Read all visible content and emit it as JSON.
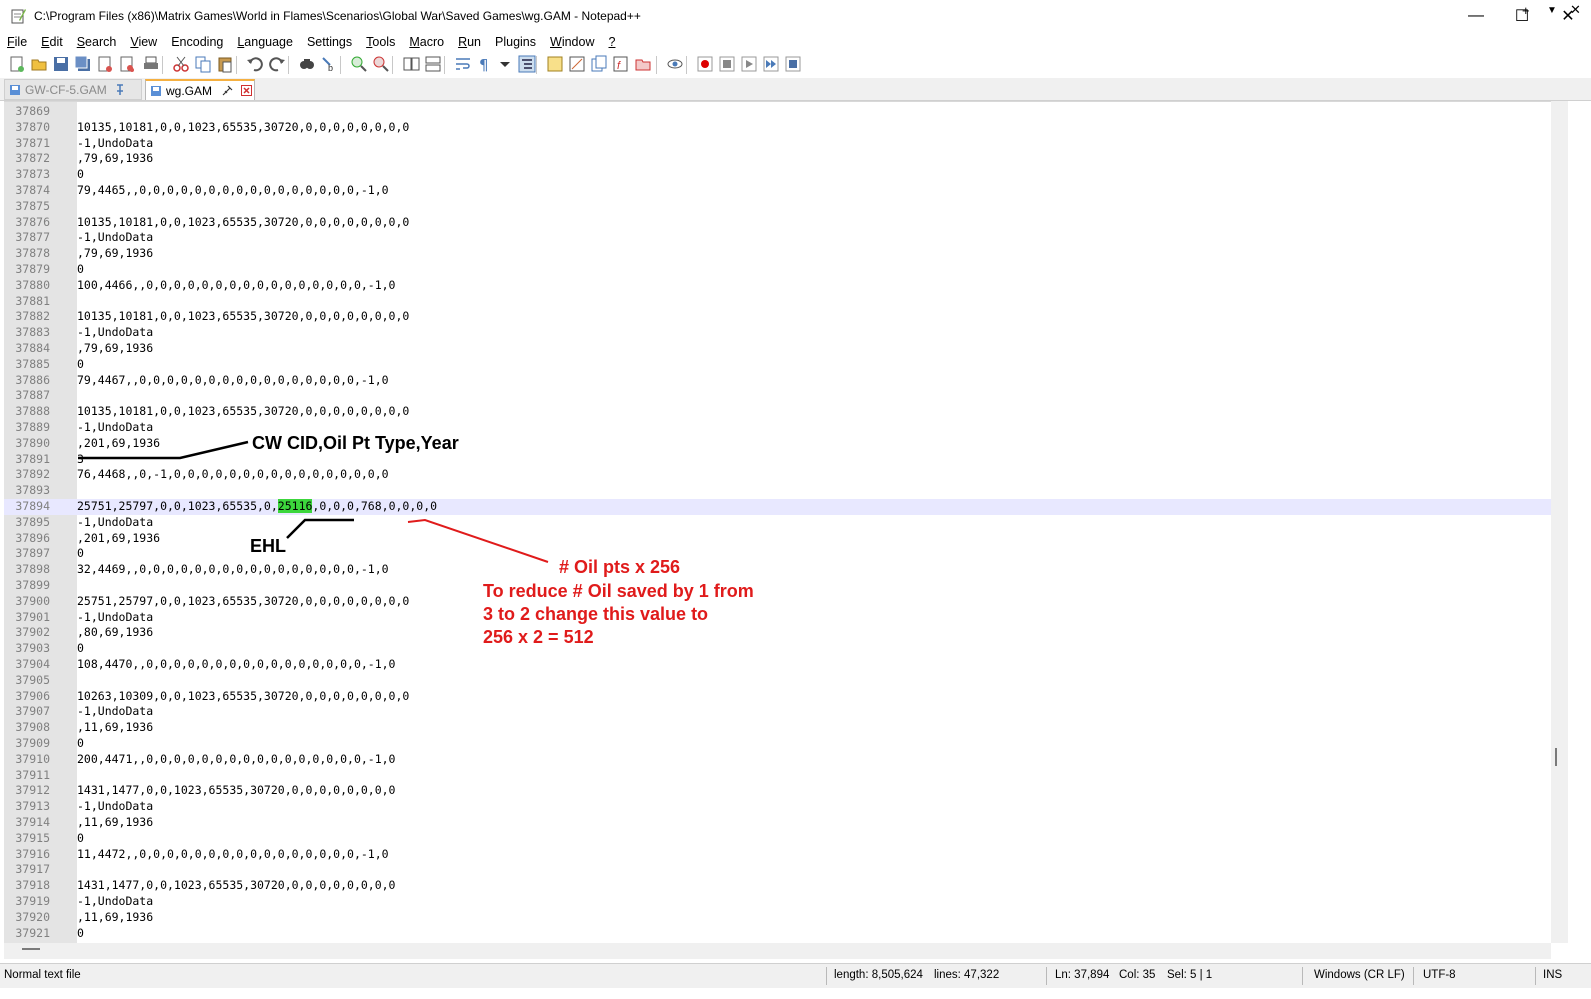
{
  "window": {
    "title": "C:\\Program Files (x86)\\Matrix Games\\World in Flames\\Scenarios\\Global War\\Saved Games\\wg.GAM - Notepad++",
    "icon": "notepad-plus-plus-icon",
    "controls": {
      "minimize": "—",
      "maximize": "☐",
      "close": "✕"
    }
  },
  "menu": {
    "items": [
      {
        "u": "F",
        "rest": "ile"
      },
      {
        "u": "E",
        "rest": "dit"
      },
      {
        "u": "S",
        "rest": "earch"
      },
      {
        "u": "V",
        "rest": "iew"
      },
      {
        "u": "",
        "rest": "Encoding"
      },
      {
        "u": "L",
        "rest": "anguage"
      },
      {
        "u": "",
        "rest": "Settings"
      },
      {
        "u": "T",
        "rest": "ools"
      },
      {
        "u": "M",
        "rest": "acro"
      },
      {
        "u": "R",
        "rest": "un"
      },
      {
        "u": "",
        "rest": "Plugins"
      },
      {
        "u": "W",
        "rest": "indow"
      },
      {
        "u": "?",
        "rest": ""
      }
    ],
    "right": {
      "plus": "+",
      "dropdown": "▼",
      "close": "✕"
    }
  },
  "tabs": [
    {
      "label": "GW-CF-5.GAM",
      "state": "inactive",
      "icon": "pin-icon"
    },
    {
      "label": "wg.GAM",
      "state": "active",
      "icon": "pin-icon",
      "close": "close-icon"
    }
  ],
  "editor": {
    "lines": [
      {
        "n": "37869",
        "t": ""
      },
      {
        "n": "37870",
        "t": "10135,10181,0,0,1023,65535,30720,0,0,0,0,0,0,0,0"
      },
      {
        "n": "37871",
        "t": "-1,UndoData"
      },
      {
        "n": "37872",
        "t": ",79,69,1936"
      },
      {
        "n": "37873",
        "t": "0"
      },
      {
        "n": "37874",
        "t": "79,4465,,0,0,0,0,0,0,0,0,0,0,0,0,0,0,0,0,-1,0"
      },
      {
        "n": "37875",
        "t": ""
      },
      {
        "n": "37876",
        "t": "10135,10181,0,0,1023,65535,30720,0,0,0,0,0,0,0,0"
      },
      {
        "n": "37877",
        "t": "-1,UndoData"
      },
      {
        "n": "37878",
        "t": ",79,69,1936"
      },
      {
        "n": "37879",
        "t": "0"
      },
      {
        "n": "37880",
        "t": "100,4466,,0,0,0,0,0,0,0,0,0,0,0,0,0,0,0,0,-1,0"
      },
      {
        "n": "37881",
        "t": ""
      },
      {
        "n": "37882",
        "t": "10135,10181,0,0,1023,65535,30720,0,0,0,0,0,0,0,0"
      },
      {
        "n": "37883",
        "t": "-1,UndoData"
      },
      {
        "n": "37884",
        "t": ",79,69,1936"
      },
      {
        "n": "37885",
        "t": "0"
      },
      {
        "n": "37886",
        "t": "79,4467,,0,0,0,0,0,0,0,0,0,0,0,0,0,0,0,0,-1,0"
      },
      {
        "n": "37887",
        "t": ""
      },
      {
        "n": "37888",
        "t": "10135,10181,0,0,1023,65535,30720,0,0,0,0,0,0,0,0"
      },
      {
        "n": "37889",
        "t": "-1,UndoData"
      },
      {
        "n": "37890",
        "t": ",201,69,1936"
      },
      {
        "n": "37891",
        "t": "3"
      },
      {
        "n": "37892",
        "t": "76,4468,,0,-1,0,0,0,0,0,0,0,0,0,0,0,0,0,0,0,0"
      },
      {
        "n": "37893",
        "t": ""
      },
      {
        "n": "37894",
        "t": "25751,25797,0,0,1023,65535,0,",
        "hl": "25116",
        "after": ",0,0,0,768,0,0,0,0",
        "current": true
      },
      {
        "n": "37895",
        "t": "-1,UndoData"
      },
      {
        "n": "37896",
        "t": ",201,69,1936"
      },
      {
        "n": "37897",
        "t": "0"
      },
      {
        "n": "37898",
        "t": "32,4469,,0,0,0,0,0,0,0,0,0,0,0,0,0,0,0,0,-1,0"
      },
      {
        "n": "37899",
        "t": ""
      },
      {
        "n": "37900",
        "t": "25751,25797,0,0,1023,65535,30720,0,0,0,0,0,0,0,0"
      },
      {
        "n": "37901",
        "t": "-1,UndoData"
      },
      {
        "n": "37902",
        "t": ",80,69,1936"
      },
      {
        "n": "37903",
        "t": "0"
      },
      {
        "n": "37904",
        "t": "108,4470,,0,0,0,0,0,0,0,0,0,0,0,0,0,0,0,0,-1,0"
      },
      {
        "n": "37905",
        "t": ""
      },
      {
        "n": "37906",
        "t": "10263,10309,0,0,1023,65535,30720,0,0,0,0,0,0,0,0"
      },
      {
        "n": "37907",
        "t": "-1,UndoData"
      },
      {
        "n": "37908",
        "t": ",11,69,1936"
      },
      {
        "n": "37909",
        "t": "0"
      },
      {
        "n": "37910",
        "t": "200,4471,,0,0,0,0,0,0,0,0,0,0,0,0,0,0,0,0,-1,0"
      },
      {
        "n": "37911",
        "t": ""
      },
      {
        "n": "37912",
        "t": "1431,1477,0,0,1023,65535,30720,0,0,0,0,0,0,0,0"
      },
      {
        "n": "37913",
        "t": "-1,UndoData"
      },
      {
        "n": "37914",
        "t": ",11,69,1936"
      },
      {
        "n": "37915",
        "t": "0"
      },
      {
        "n": "37916",
        "t": "11,4472,,0,0,0,0,0,0,0,0,0,0,0,0,0,0,0,0,-1,0"
      },
      {
        "n": "37917",
        "t": ""
      },
      {
        "n": "37918",
        "t": "1431,1477,0,0,1023,65535,30720,0,0,0,0,0,0,0,0"
      },
      {
        "n": "37919",
        "t": "-1,UndoData"
      },
      {
        "n": "37920",
        "t": ",11,69,1936"
      },
      {
        "n": "37921",
        "t": "0"
      }
    ]
  },
  "annotations": {
    "cw_label": "CW CID,Oil Pt Type,Year",
    "ehl_label": "EHL",
    "oil_title": "# Oil pts x 256",
    "oil_line1": "To reduce # Oil saved by 1 from",
    "oil_line2": "3 to 2 change this value to",
    "oil_line3": "256 x 2 = 512",
    "black": "#000000",
    "red": "#e01b1b"
  },
  "status": {
    "type": "Normal text file",
    "length": "length: 8,505,624",
    "lines": "lines: 47,322",
    "ln": "Ln: 37,894",
    "col": "Col: 35",
    "sel": "Sel: 5 | 1",
    "eol": "Windows (CR LF)",
    "encoding": "UTF-8",
    "mode": "INS"
  },
  "colors": {
    "gutter": "#e4e4e4",
    "current_line": "#e8e8ff",
    "selection": "#3cd63c",
    "tab_accent": "#f5b041"
  }
}
